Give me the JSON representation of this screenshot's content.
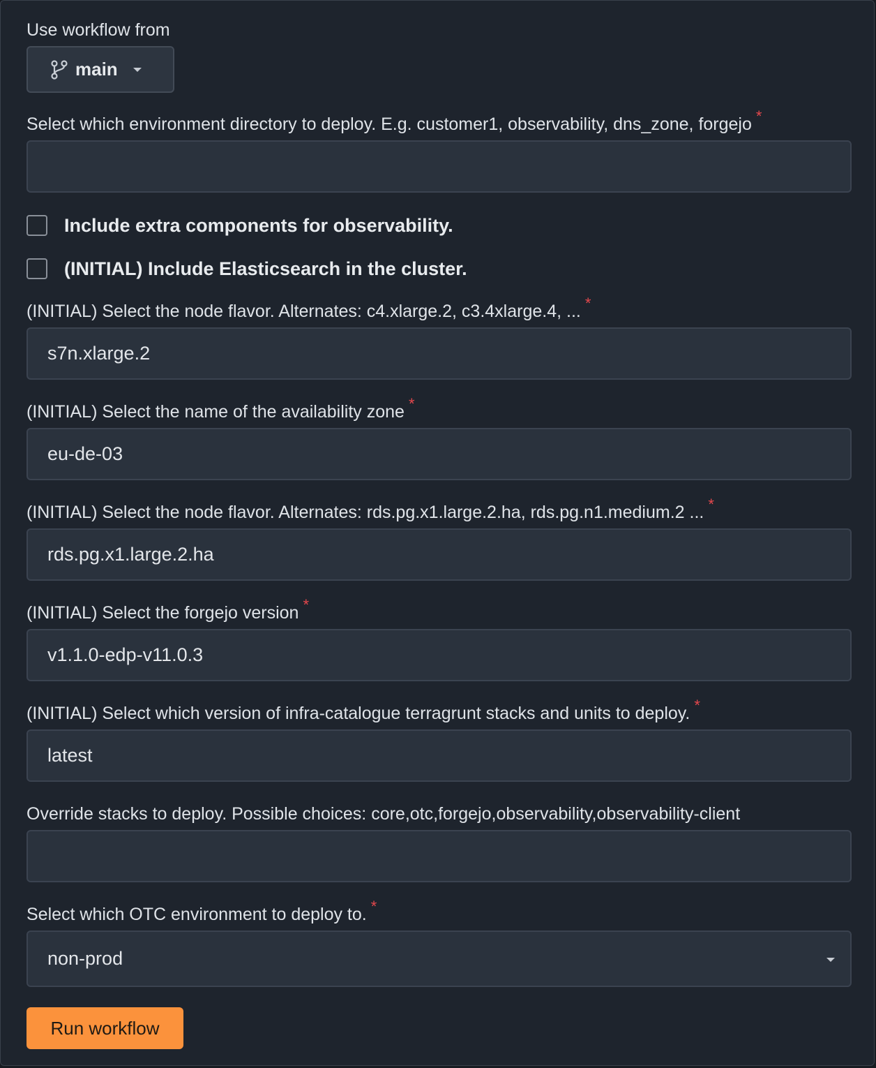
{
  "workflow_source": {
    "label": "Use workflow from",
    "branch": "main",
    "branch_icon": "git-branch-icon"
  },
  "required_marker": "*",
  "fields": {
    "environment_directory": {
      "label": "Select which environment directory to deploy. E.g. customer1, observability, dns_zone, forgejo",
      "value": "",
      "required": true
    },
    "observability_checkbox": {
      "label": "Include extra components for observability.",
      "checked": false
    },
    "elasticsearch_checkbox": {
      "label": "(INITIAL) Include Elasticsearch in the cluster.",
      "checked": false
    },
    "node_flavor": {
      "label": "(INITIAL) Select the node flavor. Alternates: c4.xlarge.2, c3.4xlarge.4, ...",
      "value": "s7n.xlarge.2",
      "required": true
    },
    "availability_zone": {
      "label": "(INITIAL) Select the name of the availability zone",
      "value": "eu-de-03",
      "required": true
    },
    "db_node_flavor": {
      "label": "(INITIAL) Select the node flavor. Alternates: rds.pg.x1.large.2.ha, rds.pg.n1.medium.2 ...",
      "value": "rds.pg.x1.large.2.ha",
      "required": true
    },
    "forgejo_version": {
      "label": "(INITIAL) Select the forgejo version",
      "value": "v1.1.0-edp-v11.0.3",
      "required": true
    },
    "infra_catalogue_version": {
      "label": "(INITIAL) Select which version of infra-catalogue terragrunt stacks and units to deploy.",
      "value": "latest",
      "required": true
    },
    "override_stacks": {
      "label": "Override stacks to deploy. Possible choices: core,otc,forgejo,observability,observability-client",
      "value": "",
      "required": false
    },
    "otc_environment": {
      "label": "Select which OTC environment to deploy to.",
      "value": "non-prod",
      "required": true
    }
  },
  "run_button": {
    "label": "Run workflow"
  },
  "colors": {
    "background": "#1e242d",
    "input_background": "#2a323d",
    "required": "#e5484d",
    "run_button": "#fb923c"
  }
}
